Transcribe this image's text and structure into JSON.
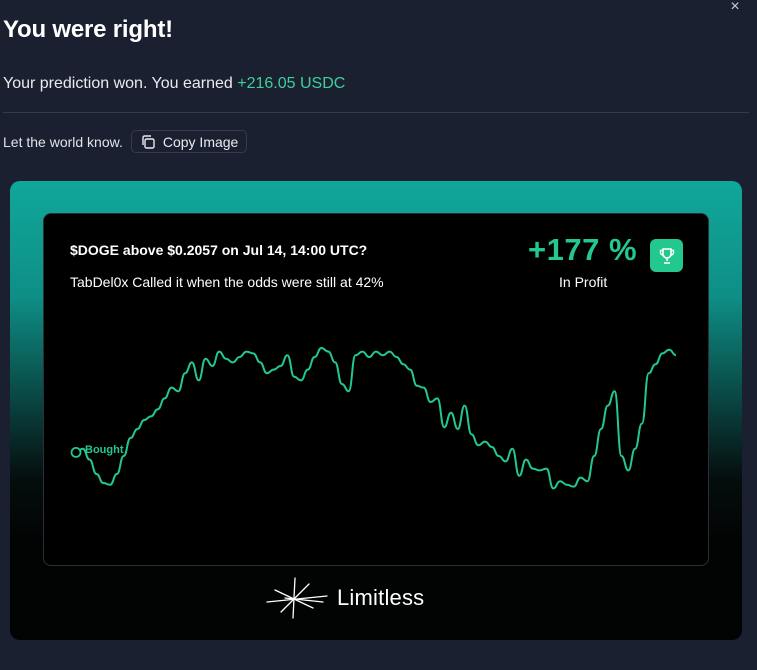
{
  "dialog": {
    "close_label": "×",
    "title": "You were right!",
    "subtitle_prefix": "Your prediction won. You earned ",
    "earned_amount": "+216.05 USDC",
    "share_label": "Let the world know.",
    "copy_button_label": "Copy Image"
  },
  "card": {
    "question": "$DOGE above $0.2057 on Jul 14, 14:00 UTC?",
    "caption": "TabDel0x Called it when the odds were still at 42%",
    "profit_percent": "+177 %",
    "profit_label": "In Profit",
    "bought_label": "Bought",
    "brand_name": "Limitless",
    "icons": {
      "trophy": "trophy-icon",
      "copy": "copy-icon",
      "logo": "limitless-logo-icon",
      "close": "close-icon"
    }
  },
  "colors": {
    "accent_green": "#23c88e",
    "earned_green": "#3ecf9a",
    "background": "#1b2030",
    "card_teal": "#11a79b"
  },
  "chart_data": {
    "type": "line",
    "title": "",
    "xlabel": "",
    "ylabel": "",
    "grid": false,
    "marker": {
      "index": 0,
      "label": "Bought"
    },
    "series": [
      {
        "values": [
          42,
          44,
          38,
          30,
          25,
          24,
          30,
          40,
          50,
          55,
          60,
          62,
          66,
          72,
          78,
          76,
          86,
          92,
          82,
          94,
          90,
          98,
          94,
          92,
          95,
          98,
          97,
          92,
          86,
          88,
          90,
          96,
          84,
          82,
          88,
          95,
          100,
          98,
          92,
          80,
          76,
          96,
          98,
          95,
          98,
          96,
          98,
          95,
          91,
          88,
          79,
          78,
          70,
          72,
          56,
          64,
          55,
          68,
          52,
          46,
          48,
          45,
          40,
          37,
          44,
          29,
          38,
          33,
          32,
          33,
          22,
          26,
          24,
          23,
          28,
          26,
          40,
          55,
          68,
          76,
          40,
          32,
          44,
          58,
          86,
          91,
          97,
          99,
          96
        ]
      }
    ]
  }
}
